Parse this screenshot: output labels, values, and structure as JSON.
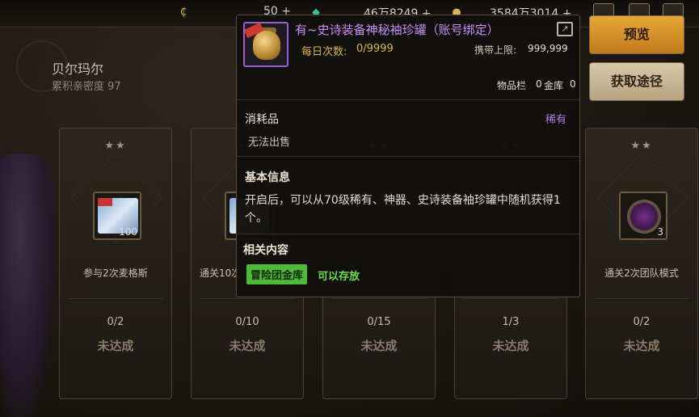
{
  "topbar": {
    "coin_value": "50",
    "gold_value": "46万8249",
    "points_value": "3584万3014",
    "plus_symbol": "+",
    "icons": [
      "coin-icon",
      "gem-icon",
      "gold-icon",
      "shop-icon",
      "mail-icon",
      "menu-icon"
    ]
  },
  "npc": {
    "name": "贝尔玛尔",
    "intimacy_label": "累积亲密度",
    "intimacy_value": "97"
  },
  "cards": [
    {
      "stars": "★★",
      "qty": "100",
      "desc": "参与2次麦格斯",
      "progress": "0/2",
      "status": "未达成",
      "item": "ticket"
    },
    {
      "stars": "★★",
      "qty": "",
      "desc": "通关10次",
      "progress": "0/10",
      "status": "未达成",
      "item": "ticket"
    },
    {
      "stars": "★★",
      "qty": "",
      "desc": "",
      "progress": "0/15",
      "status": "未达成",
      "item": "none"
    },
    {
      "stars": "★★",
      "qty": "",
      "desc": "",
      "progress": "1/3",
      "status": "未达成",
      "item": "none"
    },
    {
      "stars": "★★",
      "qty": "3",
      "desc": "通关2次团队模式",
      "progress": "0/2",
      "status": "未达成",
      "item": "orb"
    }
  ],
  "tooltip": {
    "item_name": "有~史诗装备神秘袖珍罐（账号绑定）",
    "daily_label": "每日次数:",
    "daily_value": "0/9999",
    "carry_label": "携带上限:",
    "carry_value": "999,999",
    "inventory_label": "物品栏",
    "inventory_value": "0",
    "bank_label": "金库",
    "bank_value": "0",
    "category": "消耗品",
    "rarity": "稀有",
    "no_sell": "无法出售",
    "basic_title": "基本信息",
    "basic_text": "开启后，可以从70级稀有、神器、史诗装备袖珍罐中随机获得1个。",
    "related_title": "相关内容",
    "tag_label": "冒险团金库",
    "tag_desc": "可以存放",
    "colors": {
      "name": "#c98ef7",
      "rarity": "#b27fe0",
      "tag": "#4fba3a",
      "daily": "#d7b84a"
    }
  },
  "buttons": {
    "preview": "预览",
    "obtain": "获取途径"
  },
  "colors": {
    "accent": "#e6a737",
    "frame": "#5a4d3a"
  }
}
